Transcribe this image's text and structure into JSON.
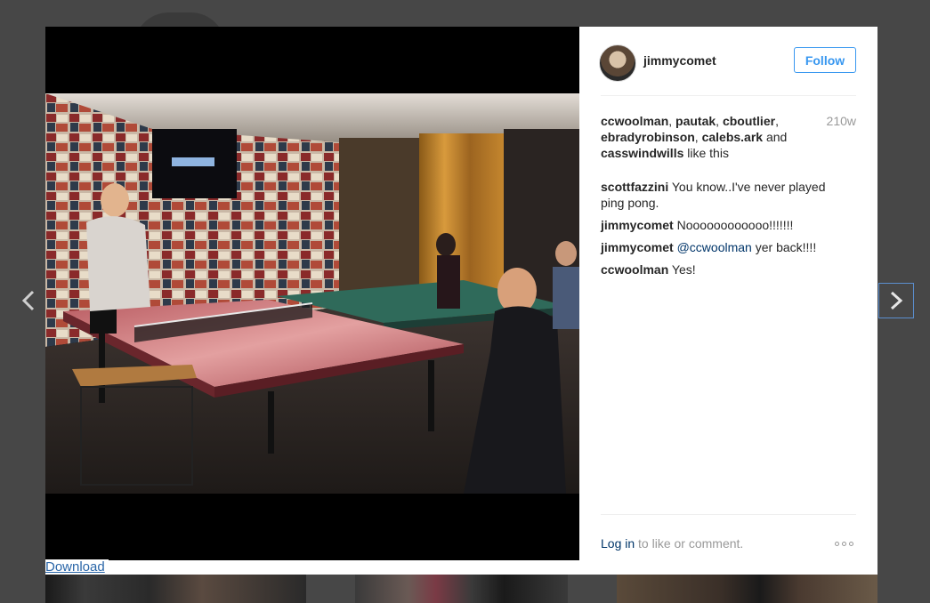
{
  "post": {
    "username": "jimmycomet",
    "follow_label": "Follow",
    "liked_by": [
      "ccwoolman",
      "pautak",
      "cboutlier",
      "ebradyrobinson",
      "calebs.ark",
      "casswindwills"
    ],
    "likes_joiner_and": "and",
    "likes_suffix": "like this",
    "age": "210w",
    "comments": [
      {
        "user": "scottfazzini",
        "text": "You know..I've never played ping pong."
      },
      {
        "user": "jimmycomet",
        "text": "Noooooooooooo!!!!!!!"
      },
      {
        "user": "jimmycomet",
        "mention": "@ccwoolman",
        "text": "yer back!!!!"
      },
      {
        "user": "ccwoolman",
        "text": "Yes!"
      }
    ],
    "login_link": "Log in",
    "login_suffix": "to like or comment.",
    "more_icon": "ellipsis-icon"
  },
  "download_label": "Download",
  "nav": {
    "prev_icon": "chevron-left-icon",
    "next_icon": "chevron-right-icon"
  },
  "colors": {
    "accent": "#3897f0",
    "link": "#003569",
    "muted": "#999999",
    "overlay": "#4a4a4a"
  }
}
